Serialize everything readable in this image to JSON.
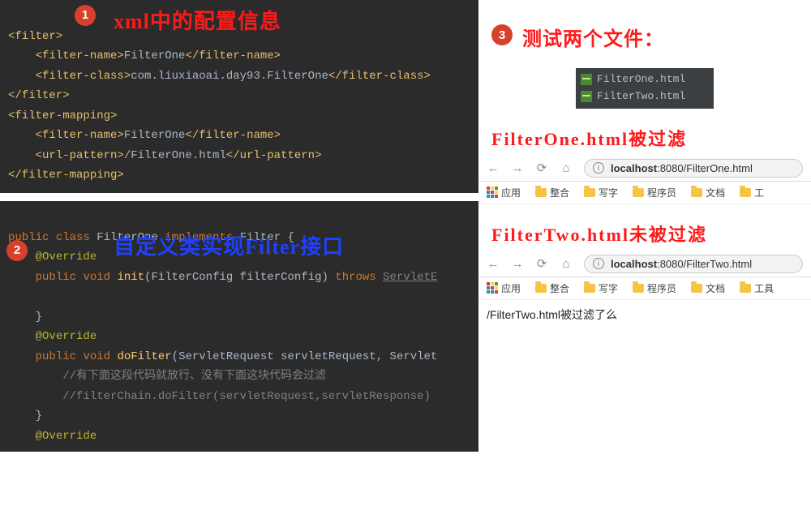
{
  "badges": {
    "one": "1",
    "two": "2",
    "three": "3"
  },
  "overlays": {
    "xml_title": "xml中的配置信息",
    "java_title": "自定义类实现Filter接口",
    "right_title": "测试两个文件："
  },
  "xml": {
    "l1_open": "<filter>",
    "l2_name_open": "<filter-name>",
    "l2_name_txt": "FilterOne",
    "l2_name_close": "</filter-name>",
    "l3_class_open": "<filter-class>",
    "l3_class_txt": "com.liuxiaoai.day93.FilterOne",
    "l3_class_close": "</filter-class>",
    "l4_close": "</filter>",
    "l5_open": "<filter-mapping>",
    "l6_name_open": "<filter-name>",
    "l6_name_txt": "FilterOne",
    "l6_name_close": "</filter-name>",
    "l7_url_open": "<url-pattern>",
    "l7_url_txt": "/FilterOne.html",
    "l7_url_close": "</url-pattern>",
    "l8_close": "</filter-mapping>"
  },
  "java": {
    "l1_public": "public",
    "l1_class": "class",
    "l1_name": "FilterOne",
    "l1_impl": "implements",
    "l1_filter": "Filter",
    "l1_brace": "{",
    "anno": "@Override",
    "l3_public": "public",
    "l3_void": "void",
    "l3_init": "init",
    "l3_params": "(FilterConfig filterConfig)",
    "l3_throws": "throws",
    "l3_exc": "ServletE",
    "l5_rbrace": "}",
    "l7_public": "public",
    "l7_void": "void",
    "l7_dofilter": "doFilter",
    "l7_params": "(ServletRequest servletRequest, Servlet",
    "l8_comment": "//有下面这段代码就放行、没有下面这块代码会过滤",
    "l9_comment": "//filterChain.doFilter(servletRequest,servletResponse)",
    "l10_rbrace": "}"
  },
  "files": {
    "one": "FilterOne.html",
    "two": "FilterTwo.html"
  },
  "sections": {
    "heading1": "FilterOne.html被过滤",
    "heading2": "FilterTwo.html未被过滤"
  },
  "browser1": {
    "url_host": "localhost",
    "url_rest": ":8080/FilterOne.html"
  },
  "browser2": {
    "url_host": "localhost",
    "url_rest": ":8080/FilterTwo.html",
    "body_text": "/FilterTwo.html被过滤了么"
  },
  "bookmarks": {
    "apps": "应用",
    "b1": "整合",
    "b2": "写字",
    "b3": "程序员",
    "b4": "文档",
    "b5": "工"
  },
  "bookmarks2": {
    "apps": "应用",
    "b1": "整合",
    "b2": "写字",
    "b3": "程序员",
    "b4": "文档",
    "b5": "工具"
  }
}
